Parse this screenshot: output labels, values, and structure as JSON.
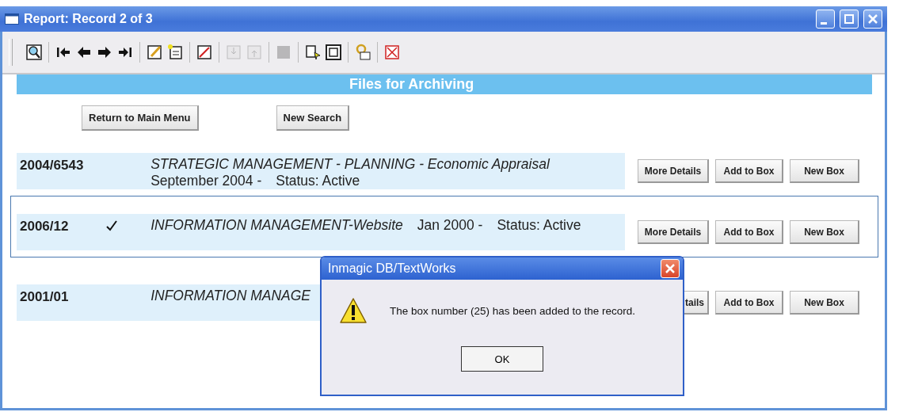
{
  "window": {
    "title": "Report: Record 2 of 3"
  },
  "toolbar": [
    {
      "disabled": false
    },
    {
      "disabled": false
    },
    {
      "disabled": false
    },
    {
      "disabled": false
    },
    {
      "disabled": false
    },
    {
      "disabled": false
    },
    {
      "disabled": false
    },
    {
      "disabled": false
    },
    {
      "disabled": true
    },
    {
      "disabled": true
    },
    {
      "disabled": true
    },
    {
      "disabled": false
    },
    {
      "disabled": false
    },
    {
      "disabled": false
    },
    {
      "disabled": false
    }
  ],
  "header": "Files for Archiving",
  "nav_buttons": [
    "Return to Main Menu",
    "New Search"
  ],
  "records": [
    {
      "number": "2004/6543",
      "checked": false,
      "selected": false,
      "title": "STRATEGIC MANAGEMENT - PLANNING - Economic Appraisal",
      "date": "September 2004 -",
      "status": "Status: Active",
      "buttons": [
        "More Details",
        "Add to Box",
        "New Box"
      ]
    },
    {
      "number": "2006/12",
      "checked": true,
      "selected": true,
      "title": "INFORMATION MANAGEMENT-Website",
      "date": "Jan 2000 -",
      "status": "Status: Active",
      "buttons": [
        "More Details",
        "Add to Box",
        "New Box"
      ]
    },
    {
      "number": "2001/01",
      "checked": false,
      "selected": false,
      "title": "INFORMATION MANAGE",
      "buttons": [
        "tails",
        "Add to Box",
        "New Box"
      ]
    }
  ],
  "dialog": {
    "title": "Inmagic DB/TextWorks",
    "message": "The box number (25) has been added to the record.",
    "button": "OK"
  }
}
